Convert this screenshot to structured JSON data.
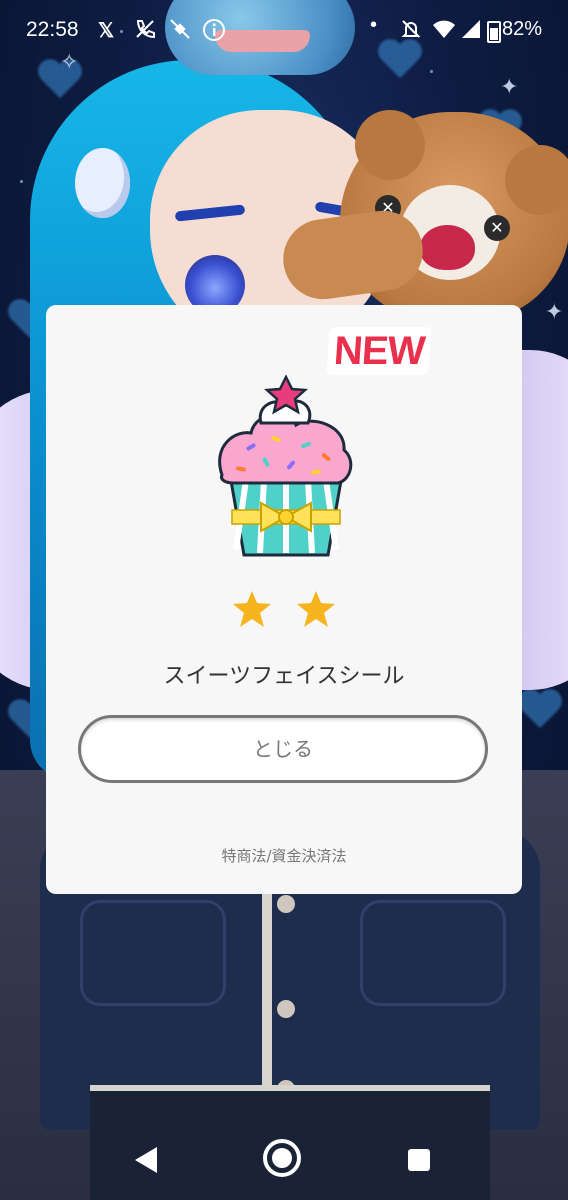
{
  "status_bar": {
    "time": "22:58",
    "icons": [
      "x-logo-icon",
      "wifi-calling-icon",
      "satellite-off-icon",
      "info-icon",
      "dot-icon",
      "do-not-disturb-icon",
      "wifi-icon",
      "signal-icon",
      "battery-icon"
    ],
    "battery": "82%"
  },
  "dialog": {
    "badge": "NEW",
    "item_image": "cupcake-icon",
    "rarity_stars": 2,
    "item_name": "スイーツフェイスシール",
    "close_label": "とじる",
    "legal_link": "特商法/資金決済法"
  },
  "nav_bar": {
    "buttons": [
      "back-icon",
      "home-icon",
      "recents-icon"
    ]
  },
  "colors": {
    "badge_red": "#e9304d",
    "star_gold": "#f5b41e",
    "dialog_bg": "#f7f7f7"
  }
}
